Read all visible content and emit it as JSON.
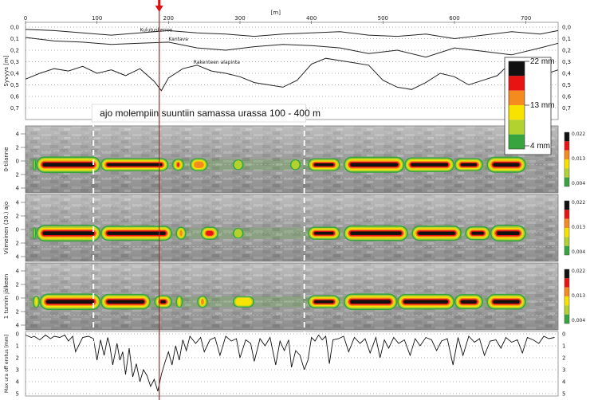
{
  "chart_data": {
    "type": "line",
    "x_unit": "[m]",
    "x_ticks": [
      0,
      100,
      200,
      300,
      400,
      500,
      600,
      700
    ],
    "xlim": [
      0,
      745
    ],
    "marker_x": 187,
    "dashed_x": [
      95,
      390
    ],
    "annotation": "ajo molempiin  suuntiin samassa urassa 100 - 400 m",
    "top_panel": {
      "ylabel": "Syvyys [m]",
      "ylim": [
        0,
        0.8
      ],
      "y_ticks": [
        "0,0",
        "0,1",
        "0,2",
        "0,3",
        "0,4",
        "0,5",
        "0,6",
        "0,7"
      ],
      "right_ticks": [
        "0,0",
        "0,1",
        "0,2",
        "0,3",
        "0,4",
        "0,5",
        "0,6",
        "0,7"
      ],
      "series": [
        {
          "name": "Kulutuskerros",
          "x": [
            0,
            40,
            80,
            120,
            160,
            200,
            240,
            280,
            320,
            360,
            400,
            440,
            480,
            520,
            560,
            600,
            640,
            680,
            720,
            745
          ],
          "y": [
            0.02,
            0.03,
            0.05,
            0.07,
            0.05,
            0.03,
            0.05,
            0.06,
            0.08,
            0.06,
            0.05,
            0.04,
            0.07,
            0.08,
            0.06,
            0.1,
            0.07,
            0.04,
            0.06,
            0.03
          ]
        },
        {
          "name": "Kantava",
          "x": [
            0,
            40,
            80,
            120,
            160,
            200,
            240,
            280,
            320,
            360,
            400,
            440,
            480,
            520,
            560,
            600,
            640,
            680,
            720,
            745
          ],
          "y": [
            0.09,
            0.12,
            0.13,
            0.15,
            0.14,
            0.13,
            0.18,
            0.2,
            0.17,
            0.15,
            0.16,
            0.18,
            0.23,
            0.2,
            0.26,
            0.18,
            0.21,
            0.24,
            0.18,
            0.14
          ]
        },
        {
          "name": "Rakenteen alapinta",
          "x": [
            0,
            20,
            40,
            60,
            80,
            100,
            120,
            140,
            160,
            180,
            190,
            200,
            220,
            240,
            260,
            280,
            300,
            320,
            340,
            360,
            380,
            400,
            420,
            440,
            460,
            480,
            500,
            520,
            540,
            560,
            580,
            600,
            620,
            640,
            660,
            680,
            700,
            720,
            745
          ],
          "y": [
            0.45,
            0.4,
            0.36,
            0.38,
            0.34,
            0.4,
            0.37,
            0.42,
            0.36,
            0.47,
            0.55,
            0.44,
            0.36,
            0.33,
            0.38,
            0.4,
            0.43,
            0.48,
            0.5,
            0.52,
            0.46,
            0.32,
            0.27,
            0.29,
            0.31,
            0.33,
            0.46,
            0.52,
            0.54,
            0.48,
            0.4,
            0.43,
            0.5,
            0.46,
            0.42,
            0.3,
            0.38,
            0.42,
            0.37
          ]
        }
      ]
    },
    "legend": {
      "labels": [
        "22 mm",
        "13 mm",
        "4 mm"
      ],
      "colors": [
        "#111111",
        "#e81414",
        "#f58a1f",
        "#f7e200",
        "#b2d230",
        "#37a43f"
      ]
    },
    "heat_panels": [
      {
        "ylabel": "0-tilanne",
        "left_ticks": [
          "4",
          "2",
          "0",
          "2",
          "4"
        ],
        "right_ticks": [
          "0,022",
          "0,013",
          "0,004"
        ],
        "segments": [
          [
            10,
            15,
            1,
            0.5
          ],
          [
            15,
            105,
            1,
            1
          ],
          [
            105,
            200,
            1,
            0.6
          ],
          [
            205,
            222,
            1,
            0.5
          ],
          [
            230,
            255,
            0.7,
            0.6
          ],
          [
            290,
            305,
            0.4,
            0.3
          ],
          [
            370,
            385,
            0.4,
            0.3
          ],
          [
            395,
            440,
            1,
            0.55
          ],
          [
            445,
            530,
            1,
            0.95
          ],
          [
            530,
            600,
            1,
            0.8
          ],
          [
            600,
            640,
            1,
            0.6
          ],
          [
            645,
            700,
            1,
            0.95
          ]
        ]
      },
      {
        "ylabel": "Viimeinen (30.) ajo",
        "left_ticks": [
          "4",
          "2",
          "0",
          "2",
          "4"
        ],
        "right_ticks": [
          "0,022",
          "0,013",
          "0,004"
        ],
        "segments": [
          [
            10,
            15,
            1,
            0.5
          ],
          [
            15,
            105,
            1,
            1
          ],
          [
            105,
            205,
            1,
            0.85
          ],
          [
            210,
            225,
            1,
            0.6
          ],
          [
            245,
            270,
            0.8,
            0.6
          ],
          [
            290,
            305,
            0.4,
            0.3
          ],
          [
            395,
            440,
            1,
            0.6
          ],
          [
            445,
            535,
            1,
            0.9
          ],
          [
            540,
            610,
            1,
            0.85
          ],
          [
            615,
            650,
            1,
            0.7
          ],
          [
            650,
            700,
            1,
            1
          ]
        ]
      },
      {
        "ylabel": "1 tunnin jälkeen",
        "left_ticks": [
          "4",
          "2",
          "0",
          "2",
          "4"
        ],
        "right_ticks": [
          "0,022",
          "0,013",
          "0,004"
        ],
        "segments": [
          [
            10,
            20,
            1,
            0.5
          ],
          [
            20,
            105,
            1,
            1
          ],
          [
            105,
            175,
            1,
            0.9
          ],
          [
            180,
            205,
            1,
            0.6
          ],
          [
            210,
            220,
            1,
            0.5
          ],
          [
            240,
            255,
            0.6,
            0.5
          ],
          [
            290,
            320,
            0.5,
            0.4
          ],
          [
            395,
            440,
            1,
            0.6
          ],
          [
            445,
            520,
            1,
            1
          ],
          [
            520,
            600,
            1,
            0.9
          ],
          [
            600,
            640,
            1,
            0.85
          ],
          [
            645,
            700,
            1,
            0.9
          ]
        ]
      }
    ],
    "bottom_panel": {
      "ylabel": "Max ura off erotus [mm]",
      "ylim": [
        0,
        5
      ],
      "y_ticks": [
        "0",
        "1",
        "2",
        "3",
        "4",
        "5"
      ],
      "right_ticks": [
        "0",
        "1",
        "2",
        "3",
        "4",
        "5"
      ],
      "series": [
        {
          "name": "",
          "x": [
            0,
            8,
            12,
            20,
            28,
            35,
            40,
            48,
            55,
            60,
            66,
            70,
            80,
            88,
            95,
            100,
            105,
            110,
            115,
            118,
            122,
            128,
            132,
            136,
            140,
            145,
            150,
            155,
            160,
            165,
            170,
            175,
            180,
            185,
            190,
            195,
            200,
            205,
            210,
            215,
            220,
            225,
            230,
            238,
            245,
            250,
            258,
            265,
            272,
            280,
            288,
            295,
            300,
            308,
            315,
            320,
            328,
            335,
            342,
            350,
            356,
            362,
            368,
            372,
            378,
            384,
            390,
            395,
            400,
            405,
            410,
            415,
            420,
            425,
            430,
            438,
            445,
            452,
            460,
            468,
            475,
            482,
            490,
            496,
            502,
            508,
            515,
            522,
            530,
            538,
            545,
            552,
            560,
            568,
            575,
            582,
            590,
            598,
            605,
            612,
            620,
            628,
            635,
            642,
            650,
            658,
            665,
            672,
            680,
            688,
            695,
            702,
            710,
            718,
            725,
            732,
            740
          ],
          "y": [
            0.1,
            0.3,
            0.2,
            0.5,
            0.1,
            0.4,
            0.2,
            0.3,
            0.1,
            0.6,
            0.2,
            1.5,
            0.3,
            0.2,
            0.4,
            2.2,
            0.5,
            1.8,
            0.3,
            1.0,
            2.6,
            0.8,
            2.2,
            1.5,
            3.4,
            1.2,
            3.6,
            2.5,
            4.0,
            3.0,
            3.5,
            4.4,
            3.8,
            4.8,
            3.4,
            2.4,
            1.5,
            2.6,
            1.0,
            2.2,
            0.5,
            1.4,
            0.2,
            0.8,
            0.3,
            1.5,
            0.5,
            0.3,
            1.8,
            0.2,
            0.6,
            0.4,
            2.0,
            0.5,
            0.8,
            2.3,
            0.4,
            1.0,
            0.3,
            2.6,
            0.6,
            1.4,
            0.5,
            2.8,
            1.4,
            1.8,
            3.0,
            2.2,
            0.3,
            0.6,
            0.1,
            0.5,
            0.2,
            2.5,
            0.5,
            0.4,
            0.2,
            1.5,
            0.3,
            0.8,
            0.4,
            1.6,
            0.3,
            2.0,
            0.5,
            1.2,
            0.3,
            0.8,
            0.5,
            1.8,
            0.4,
            1.0,
            0.3,
            0.5,
            1.4,
            0.6,
            0.4,
            2.6,
            0.3,
            1.8,
            0.2,
            0.7,
            0.4,
            1.8,
            0.6,
            0.5,
            1.2,
            0.3,
            0.7,
            0.5,
            1.6,
            0.3,
            0.5,
            0.8,
            0.2,
            0.4,
            0.3
          ]
        }
      ]
    }
  }
}
